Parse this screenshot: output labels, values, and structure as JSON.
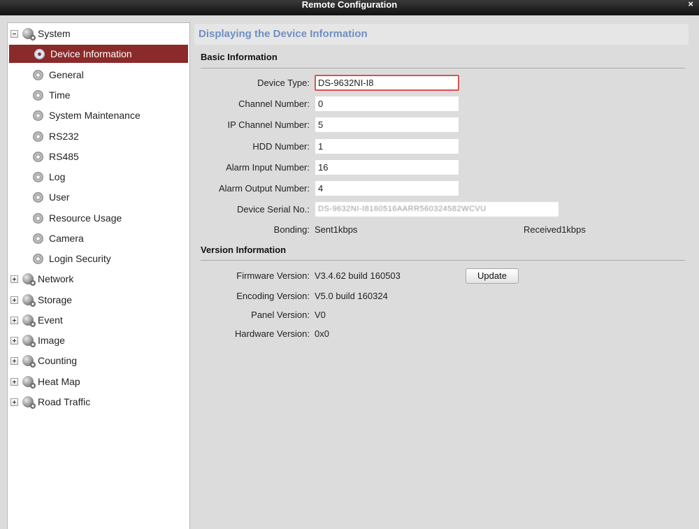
{
  "window": {
    "title": "Remote Configuration",
    "close_glyph": "×"
  },
  "tree": {
    "system": {
      "label": "System",
      "expanded": true
    },
    "system_children": [
      {
        "label": "Device Information",
        "selected": true
      },
      {
        "label": "General"
      },
      {
        "label": "Time"
      },
      {
        "label": "System Maintenance"
      },
      {
        "label": "RS232"
      },
      {
        "label": "RS485"
      },
      {
        "label": "Log"
      },
      {
        "label": "User"
      },
      {
        "label": "Resource Usage"
      },
      {
        "label": "Camera"
      },
      {
        "label": "Login Security"
      }
    ],
    "groups": [
      {
        "label": "Network"
      },
      {
        "label": "Storage"
      },
      {
        "label": "Event"
      },
      {
        "label": "Image"
      },
      {
        "label": "Counting"
      },
      {
        "label": "Heat Map"
      },
      {
        "label": "Road Traffic"
      }
    ]
  },
  "main": {
    "header": "Displaying the Device Information",
    "basic": {
      "title": "Basic Information",
      "device_type": {
        "label": "Device Type:",
        "value": "DS-9632NI-I8"
      },
      "channel_number": {
        "label": "Channel Number:",
        "value": "0"
      },
      "ip_channel_number": {
        "label": "IP Channel Number:",
        "value": "5"
      },
      "hdd_number": {
        "label": "HDD Number:",
        "value": "1"
      },
      "alarm_input_number": {
        "label": "Alarm Input Number:",
        "value": "16"
      },
      "alarm_output_number": {
        "label": "Alarm Output Number:",
        "value": "4"
      },
      "device_serial": {
        "label": "Device Serial No.:",
        "value": "DS-9632NI-I8160516AARR560324582WCVU"
      },
      "bonding": {
        "label": "Bonding:",
        "sent": "Sent1kbps",
        "received": "Received1kbps"
      }
    },
    "version": {
      "title": "Version Information",
      "firmware": {
        "label": "Firmware Version:",
        "value": "V3.4.62 build 160503"
      },
      "update_button": "Update",
      "encoding": {
        "label": "Encoding Version:",
        "value": "V5.0 build 160324"
      },
      "panel": {
        "label": "Panel Version:",
        "value": "V0"
      },
      "hardware": {
        "label": "Hardware Version:",
        "value": "0x0"
      }
    }
  }
}
